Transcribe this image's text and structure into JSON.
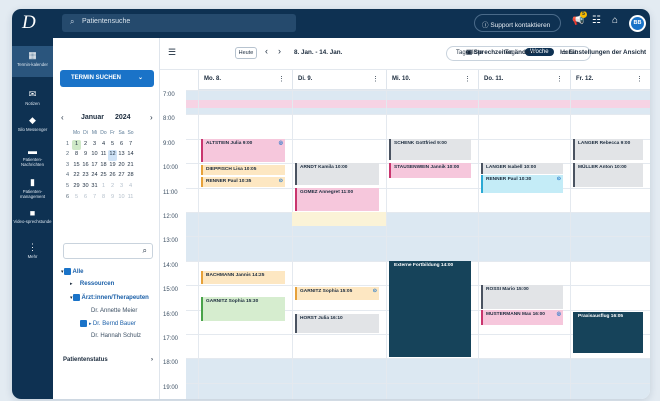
{
  "topbar": {
    "logo": "D",
    "search_placeholder": "Patientensuche",
    "support_label": "Support kontaktieren",
    "notification_count": "5",
    "avatar_initials": "BB"
  },
  "nav": [
    {
      "name": "calendar-icon",
      "label": "Termin-kalender",
      "glyph": "▦",
      "active": true
    },
    {
      "name": "mail-icon",
      "label": "Notizen",
      "glyph": "✉",
      "active": false
    },
    {
      "name": "chat-icon",
      "label": "Silo Messenger",
      "glyph": "◆",
      "active": false
    },
    {
      "name": "message-icon",
      "label": "Patienten-Nachrichten",
      "glyph": "▬",
      "active": false
    },
    {
      "name": "document-icon",
      "label": "Patienten-management",
      "glyph": "▮",
      "active": false
    },
    {
      "name": "video-icon",
      "label": "Video-sprechstunde",
      "glyph": "■",
      "active": false
    },
    {
      "name": "more-icon",
      "label": "Mehr",
      "glyph": "⋮",
      "active": false
    }
  ],
  "sidebar": {
    "new_appointment_label": "TERMIN SUCHEN",
    "month": "Januar",
    "year": "2024",
    "weekdays": [
      "Mo",
      "Di",
      "Mi",
      "Do",
      "Fr",
      "Sa",
      "So"
    ],
    "weeks": [
      {
        "wk": "1",
        "days": [
          "1",
          "2",
          "3",
          "4",
          "5",
          "6",
          "7"
        ]
      },
      {
        "wk": "2",
        "days": [
          "8",
          "9",
          "10",
          "11",
          "12",
          "13",
          "14"
        ]
      },
      {
        "wk": "3",
        "days": [
          "15",
          "16",
          "17",
          "18",
          "19",
          "20",
          "21"
        ]
      },
      {
        "wk": "4",
        "days": [
          "22",
          "23",
          "24",
          "25",
          "26",
          "27",
          "28"
        ]
      },
      {
        "wk": "5",
        "days": [
          "29",
          "30",
          "31",
          "1",
          "2",
          "3",
          "4"
        ]
      },
      {
        "wk": "6",
        "days": [
          "5",
          "6",
          "7",
          "8",
          "9",
          "10",
          "11"
        ]
      }
    ],
    "filter_placeholder": "",
    "tree_all": "Alle",
    "tree_resources": "Ressourcen",
    "tree_doctors": "Ärzt:innen/Therapeuten",
    "tree_people": [
      "Dr. Annette Meier",
      "Dr. Bernd Bauer",
      "Dr. Hannah Schulz"
    ],
    "patient_status": "Patientenstatus"
  },
  "toolbar": {
    "today": "Heute",
    "range": "8. Jan. - 14. Jan.",
    "views": [
      "Tagesliste",
      "Tag",
      "Woche",
      "Monat"
    ],
    "active_view": "Woche",
    "office_hours": "Sprechzeiten ändern",
    "view_settings": "Einstellungen der Ansicht"
  },
  "calendar": {
    "days": [
      "Mo. 8.",
      "Di. 9.",
      "Mi. 10.",
      "Do. 11.",
      "Fr. 12."
    ],
    "hours": [
      "7:00",
      "8:00",
      "9:00",
      "10:00",
      "11:00",
      "12:00",
      "13:00",
      "14:00",
      "15:00",
      "16:00",
      "17:00",
      "18:00",
      "19:00"
    ],
    "events": [
      {
        "day": 0,
        "start": "9:00",
        "end": "10:00",
        "label": "ALTSTEIN Julia 9:00",
        "bg": "#f6c7dc",
        "bar": "#c9356e",
        "icon": "◎"
      },
      {
        "day": 0,
        "start": "10:05",
        "end": "10:30",
        "label": "DIEPPISCH Lisa 10:05",
        "bg": "#fde7c2",
        "bar": "#e6a13a",
        "icon": ""
      },
      {
        "day": 0,
        "start": "10:35",
        "end": "11:00",
        "label": "RENNER Paul 10:35",
        "bg": "#fde7c2",
        "bar": "#e6a13a",
        "icon": "⊙"
      },
      {
        "day": 0,
        "start": "14:25",
        "end": "15:00",
        "label": "BACHMANN Jannis 14:25",
        "bg": "#fde7c2",
        "bar": "#e6a13a",
        "icon": ""
      },
      {
        "day": 0,
        "start": "15:30",
        "end": "16:30",
        "label": "GARNITZ Sophia 15:30",
        "bg": "#d6edcf",
        "bar": "#4aa34a",
        "icon": ""
      },
      {
        "day": 1,
        "start": "10:00",
        "end": "10:55",
        "label": "ARNDT Kamila 10:00",
        "bg": "#e2e4e7",
        "bar": "#4a5361",
        "icon": ""
      },
      {
        "day": 1,
        "start": "11:00",
        "end": "12:00",
        "label": "GOMEZ Annegret 11:00",
        "bg": "#f6c7dc",
        "bar": "#c9356e",
        "icon": ""
      },
      {
        "day": 1,
        "start": "15:05",
        "end": "15:40",
        "label": "GARNITZ Sophia 15:05",
        "bg": "#fde7c2",
        "bar": "#e6a13a",
        "icon": "⊙"
      },
      {
        "day": 1,
        "start": "16:10",
        "end": "17:00",
        "label": "HORST Julia 16:10",
        "bg": "#e2e4e7",
        "bar": "#4a5361",
        "icon": ""
      },
      {
        "day": 2,
        "start": "9:00",
        "end": "9:55",
        "label": "SCHENK Gottfried 9:00",
        "bg": "#e2e4e7",
        "bar": "#4a5361",
        "icon": ""
      },
      {
        "day": 2,
        "start": "10:00",
        "end": "10:40",
        "label": "STAUSENWEIN Jannik 10:00",
        "bg": "#f6c7dc",
        "bar": "#c9356e",
        "icon": ""
      },
      {
        "day": 2,
        "start": "14:00",
        "end": "18:00",
        "label": "Externe Fortbildung 14:00",
        "bg": "#16435a",
        "bar": "#16435a",
        "icon": "",
        "light": true
      },
      {
        "day": 3,
        "start": "10:00",
        "end": "10:30",
        "label": "LANGER Isabell 10:00",
        "bg": "#e2e4e7",
        "bar": "#4a5361",
        "icon": ""
      },
      {
        "day": 3,
        "start": "10:30",
        "end": "11:15",
        "label": "RENNER Paul 10:30",
        "bg": "#c4ecf7",
        "bar": "#2aa9d4",
        "icon": "⊙"
      },
      {
        "day": 3,
        "start": "15:00",
        "end": "16:00",
        "label": "ROSSI Mario 15:00",
        "bg": "#e2e4e7",
        "bar": "#4a5361",
        "icon": ""
      },
      {
        "day": 3,
        "start": "16:00",
        "end": "16:40",
        "label": "MUSTERMANN Max 16:00",
        "bg": "#f6c7dc",
        "bar": "#c9356e",
        "icon": "◎"
      },
      {
        "day": 4,
        "start": "9:00",
        "end": "9:55",
        "label": "LANGER Rebecca 9:00",
        "bg": "#e2e4e7",
        "bar": "#4a5361",
        "icon": ""
      },
      {
        "day": 4,
        "start": "10:00",
        "end": "11:00",
        "label": "MÜLLER Anton 10:00",
        "bg": "#e2e4e7",
        "bar": "#4a5361",
        "icon": ""
      },
      {
        "day": 4,
        "start": "16:05",
        "end": "17:50",
        "label": "Praxisausflug 16:05",
        "bg": "#16435a",
        "bar": "#16435a",
        "icon": "",
        "light": true
      }
    ]
  },
  "colors": {
    "navy": "#0e3152",
    "accent": "#1a73c8",
    "closed_band": "#dce8f2",
    "lunch": "#fbf3d7",
    "pink_band": "#f6d3e4"
  }
}
